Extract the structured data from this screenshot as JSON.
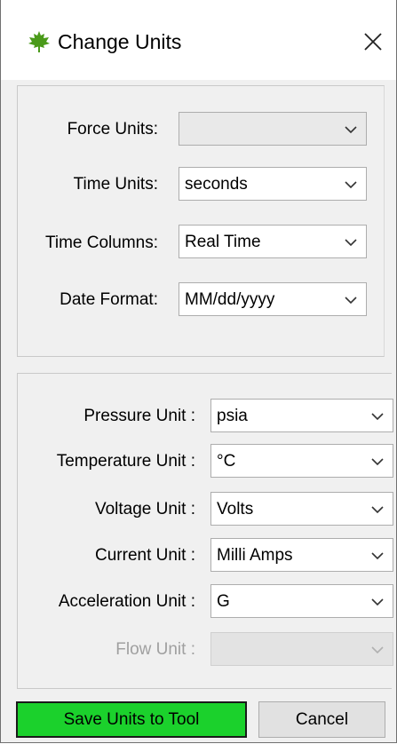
{
  "window": {
    "title": "Change Units",
    "icon": "maple-leaf-icon",
    "close_icon": "close-icon"
  },
  "general_units": {
    "force": {
      "label": "Force Units:",
      "value": ""
    },
    "time": {
      "label": "Time Units:",
      "value": "seconds"
    },
    "time_columns": {
      "label": "Time Columns:",
      "value": "Real Time"
    },
    "date_format": {
      "label": "Date Format:",
      "value": "MM/dd/yyyy"
    }
  },
  "sensor_units": {
    "pressure": {
      "label": "Pressure Unit :",
      "value": "psia"
    },
    "temperature": {
      "label": "Temperature Unit :",
      "value": "°C"
    },
    "voltage": {
      "label": "Voltage Unit :",
      "value": "Volts"
    },
    "current": {
      "label": "Current Unit :",
      "value": "Milli Amps"
    },
    "acceleration": {
      "label": "Acceleration Unit :",
      "value": "G"
    },
    "flow": {
      "label": "Flow Unit :",
      "value": "",
      "enabled": false
    }
  },
  "buttons": {
    "save_label": "Save Units to Tool",
    "cancel_label": "Cancel"
  },
  "colors": {
    "save_button": "#1bd12c",
    "window_bg": "#f0f0f0",
    "icon_green": "#4a9a1a"
  }
}
